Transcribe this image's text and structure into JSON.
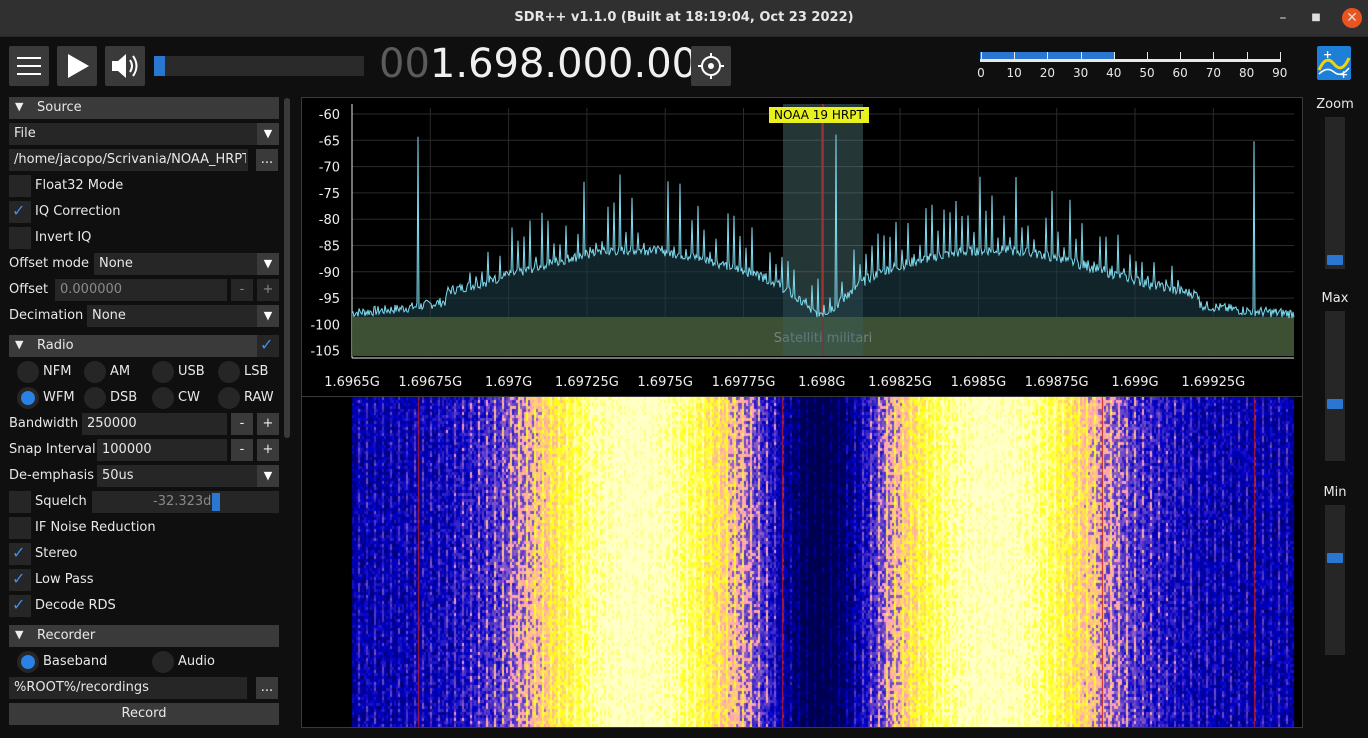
{
  "window": {
    "title": "SDR++ v1.1.0 (Built at 18:19:04, Oct 23 2022)"
  },
  "toolbar": {
    "frequency_dim": "00",
    "frequency_main": "1.698.000.000",
    "volume_level": 0.05,
    "snr_level": 0.45,
    "snr_ticks": [
      "0",
      "10",
      "20",
      "30",
      "40",
      "50",
      "60",
      "70",
      "80",
      "90"
    ]
  },
  "source": {
    "header": "Source",
    "type": "File",
    "path": "/home/jacopo/Scrivania/NOAA_HRPT_",
    "browse": "...",
    "float32": {
      "label": "Float32 Mode",
      "checked": false
    },
    "iq_correction": {
      "label": "IQ Correction",
      "checked": true
    },
    "invert_iq": {
      "label": "Invert IQ",
      "checked": false
    },
    "offset_mode_label": "Offset mode",
    "offset_mode": "None",
    "offset_label": "Offset",
    "offset_value": "0.000000",
    "decimation_label": "Decimation",
    "decimation": "None"
  },
  "radio": {
    "header": "Radio",
    "modes": [
      "NFM",
      "AM",
      "USB",
      "LSB",
      "WFM",
      "DSB",
      "CW",
      "RAW"
    ],
    "selected_mode": "WFM",
    "bandwidth_label": "Bandwidth",
    "bandwidth": "250000",
    "snap_label": "Snap Interval",
    "snap": "100000",
    "deemph_label": "De-emphasis",
    "deemph": "50us",
    "squelch_label": "Squelch",
    "squelch_value": "-32.323dB",
    "if_nr_label": "IF Noise Reduction",
    "stereo_label": "Stereo",
    "lowpass_label": "Low Pass",
    "rds_label": "Decode RDS"
  },
  "recorder": {
    "header": "Recorder",
    "baseband": "Baseband",
    "audio": "Audio",
    "path": "%ROOT%/recordings",
    "browse": "...",
    "record": "Record"
  },
  "fft": {
    "y_ticks": [
      "-60",
      "-65",
      "-70",
      "-75",
      "-80",
      "-85",
      "-90",
      "-95",
      "-100",
      "-105"
    ],
    "x_ticks": [
      "1.6965G",
      "1.69675G",
      "1.697G",
      "1.69725G",
      "1.6975G",
      "1.69775G",
      "1.698G",
      "1.69825G",
      "1.6985G",
      "1.69875G",
      "1.699G",
      "1.69925G"
    ],
    "vfo_label": "NOAA 19 HRPT",
    "band_label": "Satelliti militari"
  },
  "right": {
    "zoom": "Zoom",
    "max": "Max",
    "min": "Min"
  },
  "colors": {
    "accent": "#2a76d1",
    "trace": "#7fdcf0",
    "band": "#7a7a1c",
    "vfo_label_bg": "#e8f020"
  }
}
